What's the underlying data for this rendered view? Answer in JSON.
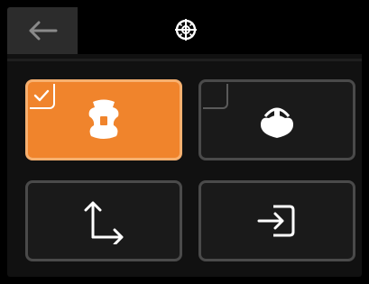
{
  "header": {
    "back_icon": "arrow-left-icon",
    "title_icon": "crosshair-globe-icon"
  },
  "colors": {
    "accent": "#f0842c",
    "accent_border": "#f7b06f",
    "tile_bg": "#1a1a1a",
    "tile_border": "#4a4a4a",
    "icon": "#ffffff"
  },
  "tiles": [
    {
      "icon": "print-head-front-icon",
      "selected": true
    },
    {
      "icon": "print-head-side-icon",
      "selected": false
    },
    {
      "icon": "axes-move-icon"
    },
    {
      "icon": "enter-import-icon"
    }
  ]
}
